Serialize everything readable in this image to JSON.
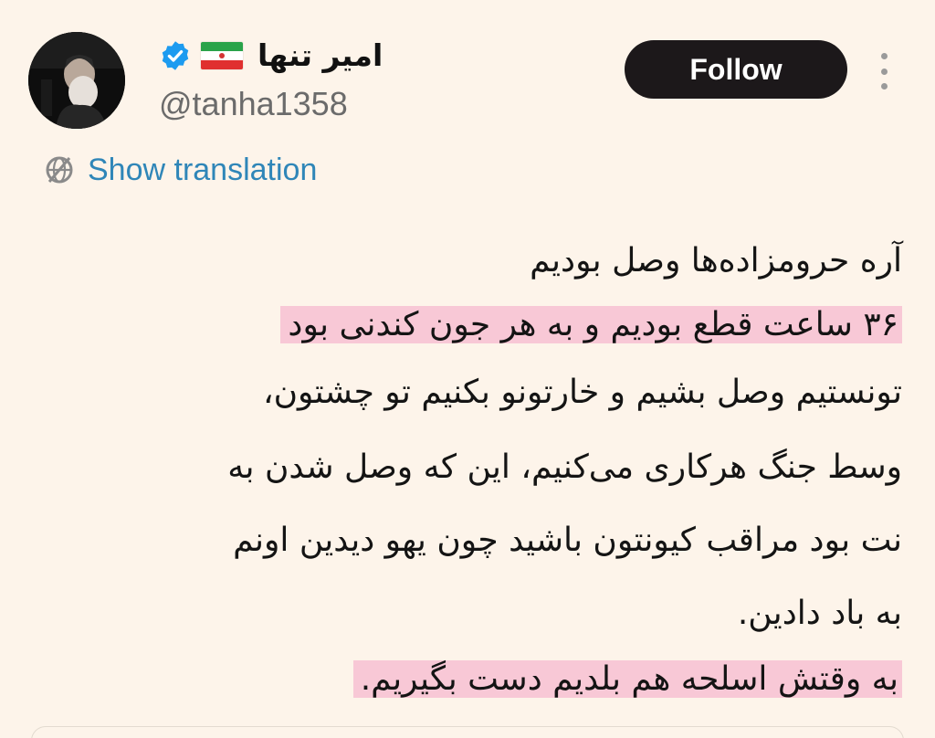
{
  "profile": {
    "display_name": "امیر تنها",
    "handle": "@tanha1358",
    "verified_icon": "verified-check-icon",
    "flag_icon": "iran-flag-icon",
    "avatar": "profile-photo"
  },
  "actions": {
    "follow_label": "Follow",
    "more_icon": "more-vertical-icon"
  },
  "translation": {
    "label": "Show translation",
    "icon": "translate-globe-icon"
  },
  "tweet": {
    "lines": [
      "آره حرومزاده‌ها وصل بودیم",
      "۳۶ ساعت قطع بودیم و به هر جون کندنی بود",
      "تونستیم وصل بشیم و خارتونو بکنیم تو چشتون،",
      "وسط جنگ هرکاری می‌کنیم، این که وصل شدن به",
      "نت بود مراقب کیونتون باشید چون یهو دیدین اونم",
      "به باد دادین.",
      "به وقتش اسلحه هم بلدیم دست بگیریم."
    ],
    "highlighted_lines": [
      1,
      6
    ]
  },
  "colors": {
    "background": "#fdf4ea",
    "highlight": "#f8c8d6",
    "follow_button": "#1c181a",
    "link": "#2f86b8",
    "verified": "#1d9bf0"
  }
}
